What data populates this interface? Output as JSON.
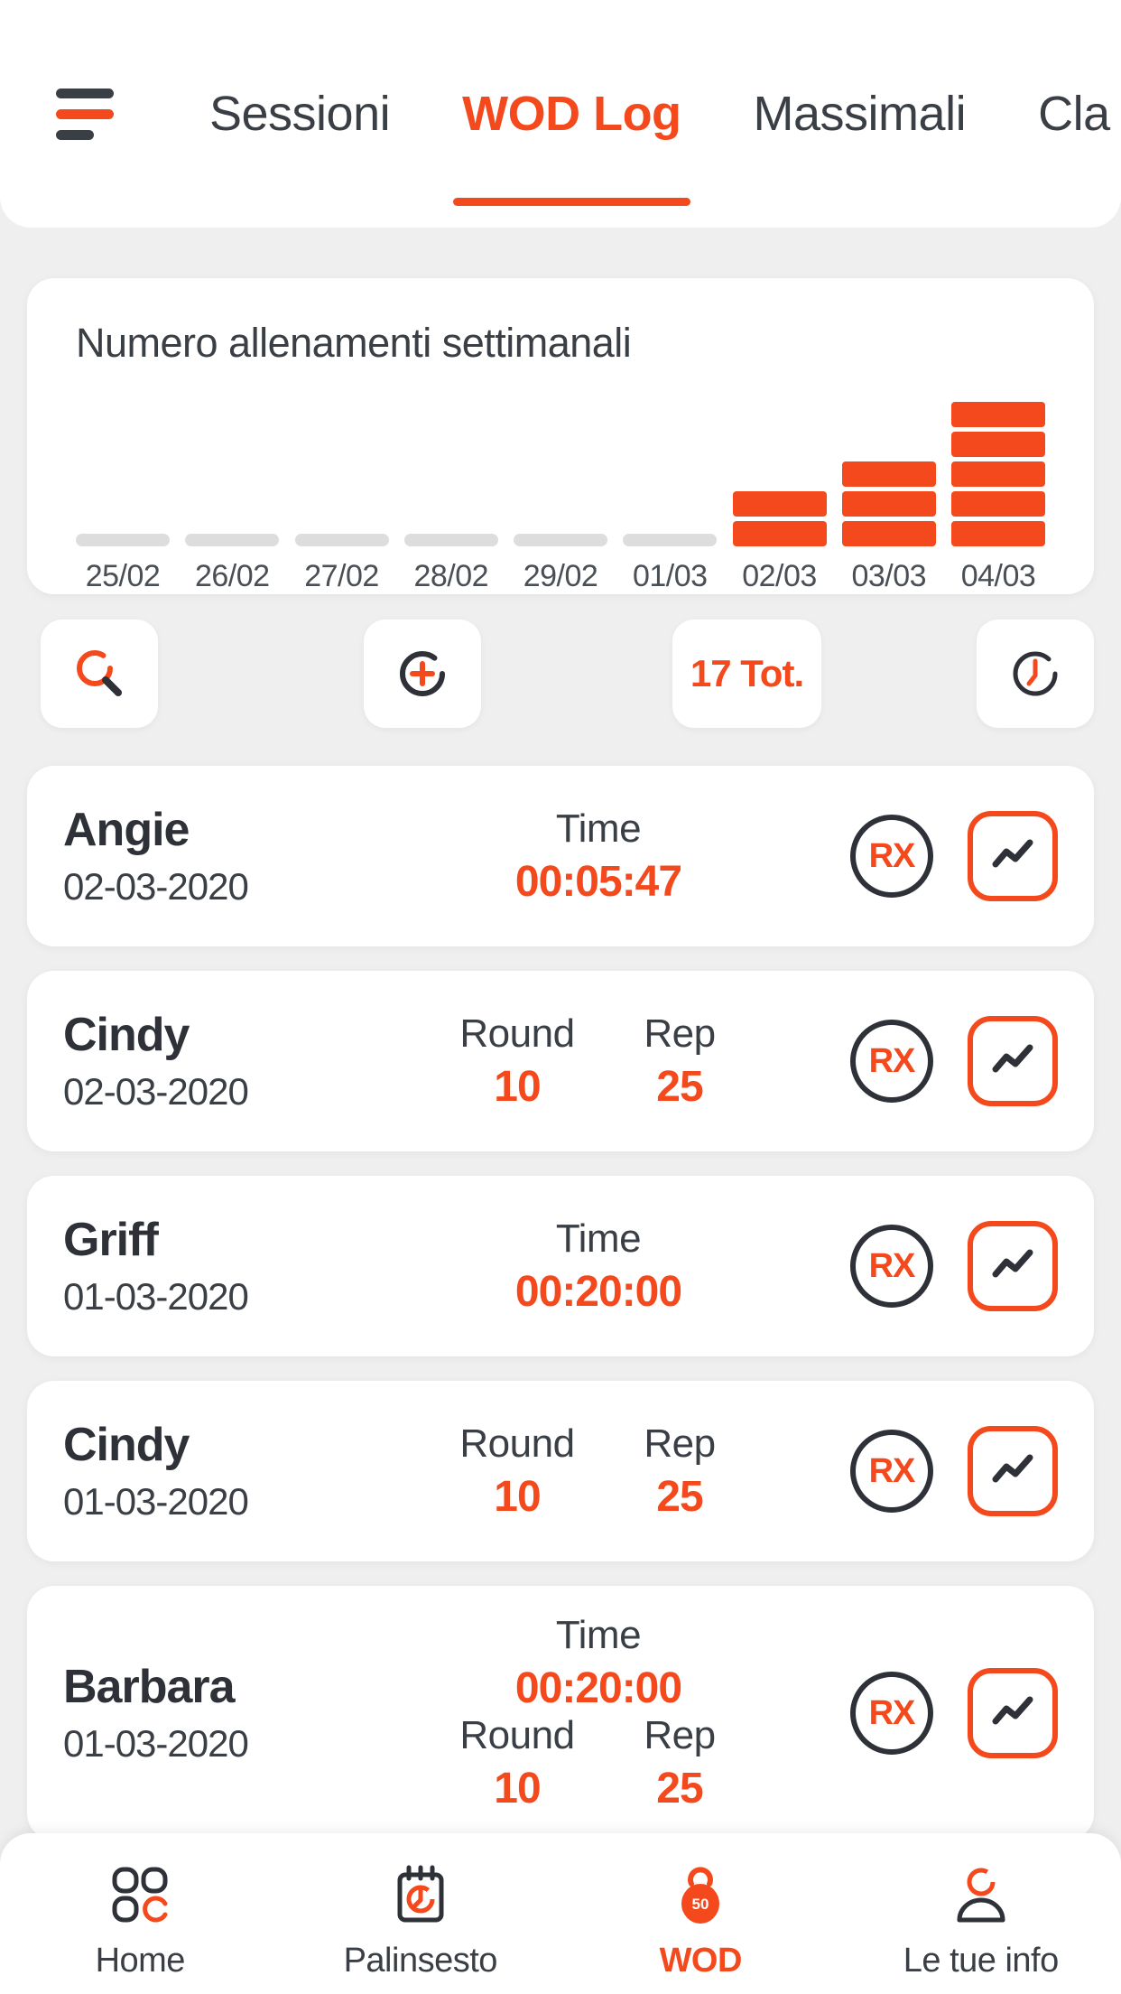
{
  "colors": {
    "accent": "#f4491c",
    "dark": "#2e3238",
    "bg": "#efefef",
    "gray_bar": "#dddddd"
  },
  "header": {
    "menu_icon": "hamburger-icon",
    "tabs": [
      {
        "label": "Sessioni",
        "active": false
      },
      {
        "label": "WOD Log",
        "active": true
      },
      {
        "label": "Massimali",
        "active": false
      },
      {
        "label": "Cla",
        "active": false
      }
    ]
  },
  "chart_card": {
    "title": "Numero allenamenti settimanali"
  },
  "chart_data": {
    "type": "bar",
    "title": "Numero allenamenti settimanali",
    "categories": [
      "25/02",
      "26/02",
      "27/02",
      "28/02",
      "29/02",
      "01/03",
      "02/03",
      "03/03",
      "04/03"
    ],
    "values": [
      0,
      0,
      0,
      0,
      0,
      0,
      2,
      3,
      5
    ],
    "xlabel": "",
    "ylabel": "",
    "ylim": [
      0,
      5
    ],
    "grid": false,
    "legend": "none",
    "note": "stacked segment bars; zero days drawn as flat gray placeholder"
  },
  "toolbar": {
    "search_icon": "search-icon",
    "add_icon": "add-circle-icon",
    "total_label": "17 Tot.",
    "clock_icon": "clock-icon"
  },
  "wod_rows": [
    {
      "name": "Angie",
      "date": "02-03-2020",
      "metrics": [
        {
          "label": "Time",
          "value": "00:05:47"
        }
      ],
      "rx": "RX",
      "chart_icon": "line-chart-icon"
    },
    {
      "name": "Cindy",
      "date": "02-03-2020",
      "metrics": [
        {
          "label": "Round",
          "value": "10"
        },
        {
          "label": "Rep",
          "value": "25"
        }
      ],
      "rx": "RX",
      "chart_icon": "line-chart-icon"
    },
    {
      "name": "Griff",
      "date": "01-03-2020",
      "metrics": [
        {
          "label": "Time",
          "value": "00:20:00"
        }
      ],
      "rx": "RX",
      "chart_icon": "line-chart-icon"
    },
    {
      "name": "Cindy",
      "date": "01-03-2020",
      "metrics": [
        {
          "label": "Round",
          "value": "10"
        },
        {
          "label": "Rep",
          "value": "25"
        }
      ],
      "rx": "RX",
      "chart_icon": "line-chart-icon"
    },
    {
      "name": "Barbara",
      "date": "01-03-2020",
      "metrics": [
        {
          "label": "Time",
          "value": "00:20:00"
        }
      ],
      "metrics2": [
        {
          "label": "Round",
          "value": "10"
        },
        {
          "label": "Rep",
          "value": "25"
        }
      ],
      "rx": "RX",
      "chart_icon": "line-chart-icon"
    }
  ],
  "bottom_nav": [
    {
      "label": "Home",
      "icon": "grid-icon",
      "active": false,
      "badge": ""
    },
    {
      "label": "Palinsesto",
      "icon": "calendar-clock-icon",
      "active": false,
      "badge": ""
    },
    {
      "label": "WOD",
      "icon": "kettlebell-icon",
      "active": true,
      "badge": "50"
    },
    {
      "label": "Le tue info",
      "icon": "person-icon",
      "active": false,
      "badge": ""
    }
  ]
}
